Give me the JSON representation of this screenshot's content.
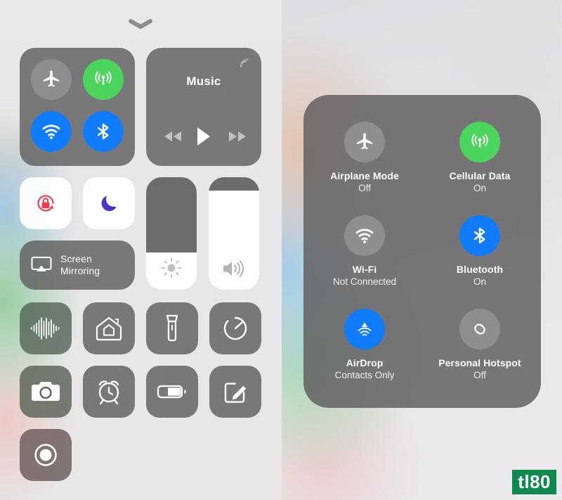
{
  "watermark": {
    "text": "tl80",
    "bg": "#0e8a4f",
    "fg": "#ffffff"
  },
  "colors": {
    "tile_gray": "#5c5c5c",
    "active_green": "#4cd55c",
    "active_blue": "#107bfb",
    "inactive_gray": "#8e8e8e",
    "rotation_red": "#ee3b4e",
    "dnd_purple": "#4b35c8",
    "panel_gray": "#605f60"
  },
  "left_panel": {
    "handle": {
      "icon": "chevron-down-icon"
    },
    "connectivity": {
      "toggles": [
        {
          "id": "airplane",
          "icon": "airplane-icon",
          "state": "off",
          "color": "#8e8e8e"
        },
        {
          "id": "cellular",
          "icon": "cellular-data-icon",
          "state": "on",
          "color": "#4cd55c"
        },
        {
          "id": "wifi",
          "icon": "wifi-icon",
          "state": "on",
          "color": "#107bfb"
        },
        {
          "id": "bluetooth",
          "icon": "bluetooth-icon",
          "state": "on",
          "color": "#107bfb"
        }
      ]
    },
    "music": {
      "title": "Music",
      "airplay_icon": "airplay-audio-icon",
      "controls": [
        {
          "id": "previous",
          "icon": "rewind-icon"
        },
        {
          "id": "play",
          "icon": "play-icon"
        },
        {
          "id": "next",
          "icon": "fast-forward-icon"
        }
      ]
    },
    "toggles": [
      {
        "id": "rotation-lock",
        "icon": "rotation-lock-icon",
        "state": "on",
        "color": "#ee3b4e"
      },
      {
        "id": "do-not-disturb",
        "icon": "moon-icon",
        "state": "off",
        "color": "#4b35c8"
      }
    ],
    "screen_mirroring": {
      "icon": "airplay-screen-icon",
      "label_line1": "Screen",
      "label_line2": "Mirroring"
    },
    "sliders": [
      {
        "id": "brightness",
        "icon": "brightness-icon",
        "value": 33
      },
      {
        "id": "volume",
        "icon": "volume-icon",
        "value": 88
      }
    ],
    "shortcuts": [
      {
        "id": "hearing",
        "icon": "audio-waveform-icon"
      },
      {
        "id": "home",
        "icon": "home-icon"
      },
      {
        "id": "flashlight",
        "icon": "flashlight-icon"
      },
      {
        "id": "timer",
        "icon": "timer-icon"
      },
      {
        "id": "camera",
        "icon": "camera-icon"
      },
      {
        "id": "alarm",
        "icon": "alarm-clock-icon"
      },
      {
        "id": "low-power-mode",
        "icon": "battery-icon"
      },
      {
        "id": "notes",
        "icon": "compose-note-icon"
      },
      {
        "id": "screen-recording",
        "icon": "record-icon"
      }
    ]
  },
  "expanded_panel": {
    "cells": [
      {
        "id": "airplane-mode",
        "icon": "airplane-icon",
        "title": "Airplane Mode",
        "state": "Off",
        "active": false,
        "color": "#8e8e8e"
      },
      {
        "id": "cellular-data",
        "icon": "cellular-data-icon",
        "title": "Cellular Data",
        "state": "On",
        "active": true,
        "color": "#4cd55c"
      },
      {
        "id": "wifi",
        "icon": "wifi-icon",
        "title": "Wi-Fi",
        "state": "Not Connected",
        "active": false,
        "color": "#8e8e8e"
      },
      {
        "id": "bluetooth",
        "icon": "bluetooth-icon",
        "title": "Bluetooth",
        "state": "On",
        "active": true,
        "color": "#107bfb"
      },
      {
        "id": "airdrop",
        "icon": "airdrop-icon",
        "title": "AirDrop",
        "state": "Contacts Only",
        "active": true,
        "color": "#107bfb"
      },
      {
        "id": "personal-hotspot",
        "icon": "hotspot-icon",
        "title": "Personal Hotspot",
        "state": "Off",
        "active": false,
        "color": "#8e8e8e"
      }
    ]
  }
}
